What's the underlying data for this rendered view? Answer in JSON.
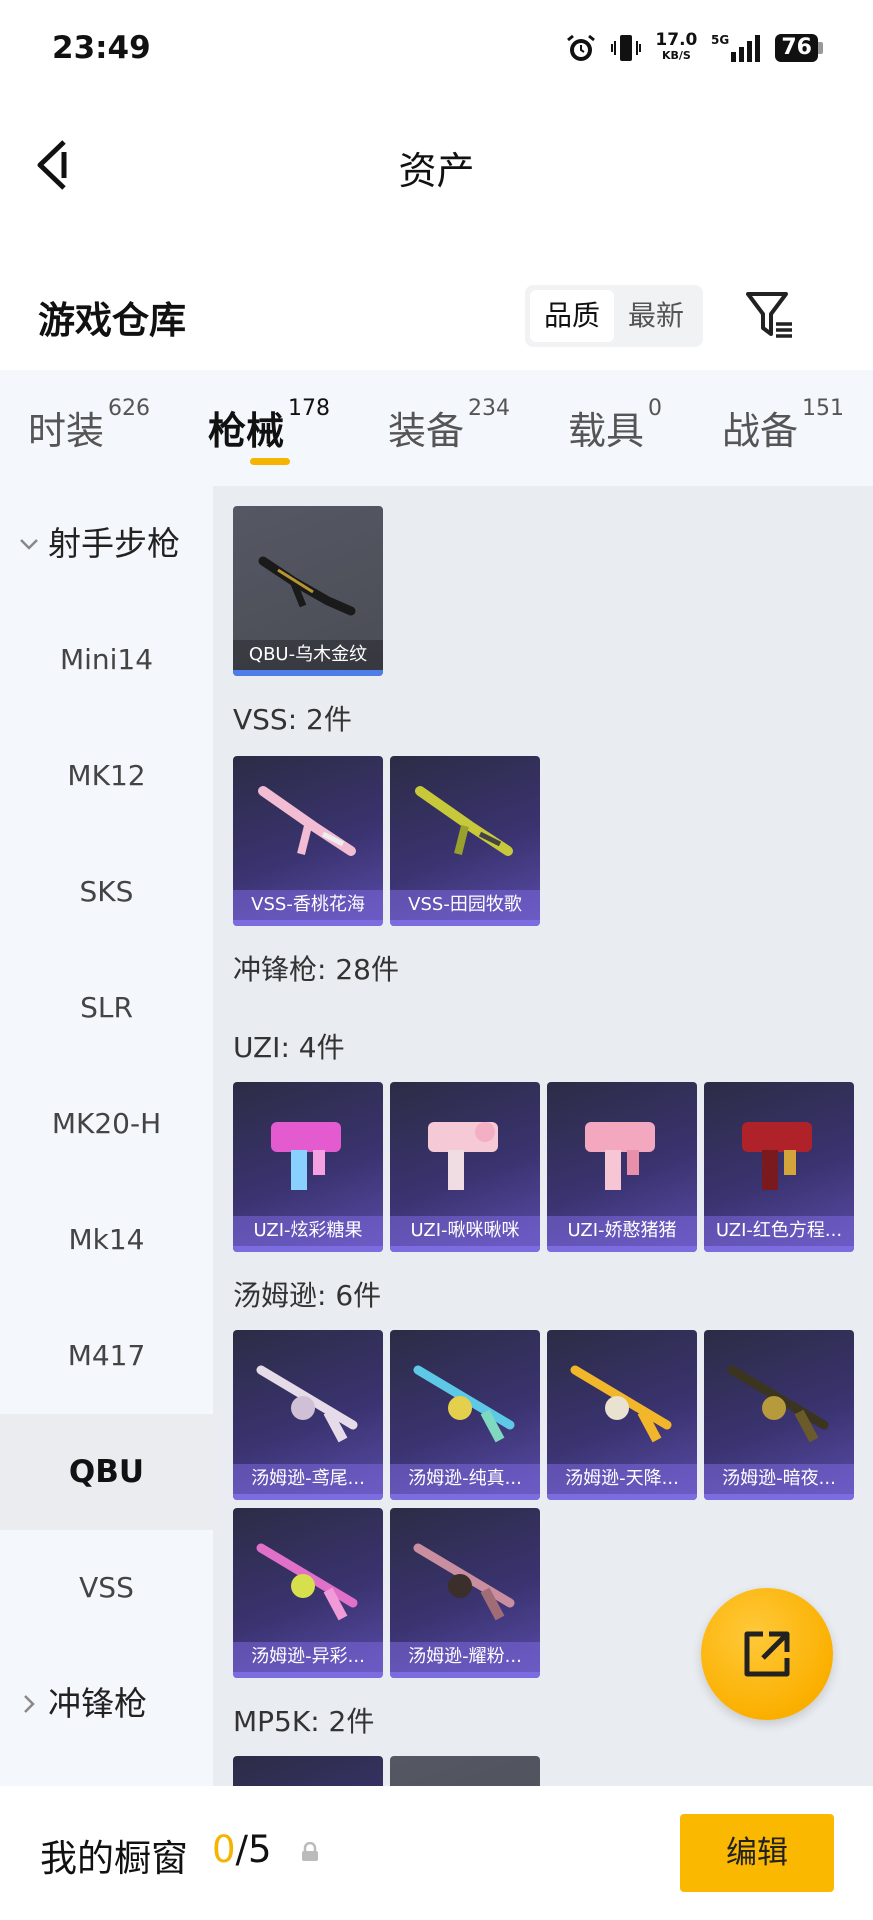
{
  "status_bar": {
    "time": "23:49",
    "net_speed": "17.0",
    "net_unit": "KB/S",
    "network": "5G",
    "battery": "76"
  },
  "nav": {
    "title": "资产"
  },
  "section": {
    "title": "游戏仓库",
    "sort_options": [
      "品质",
      "最新"
    ],
    "sort_selected": "品质"
  },
  "tabs": [
    {
      "label": "时装",
      "count": "626"
    },
    {
      "label": "枪械",
      "count": "178"
    },
    {
      "label": "装备",
      "count": "234"
    },
    {
      "label": "载具",
      "count": "0"
    },
    {
      "label": "战备",
      "count": "151"
    }
  ],
  "sidebar": {
    "group_1": "射手步枪",
    "items": [
      "Mini14",
      "MK12",
      "SKS",
      "SLR",
      "MK20-H",
      "Mk14",
      "M417",
      "QBU",
      "VSS"
    ],
    "active_item": "QBU",
    "group_2": "冲锋枪"
  },
  "content": {
    "qbu_cards": [
      "QBU-乌木金纹"
    ],
    "vss_label": "VSS: 2件",
    "vss_cards": [
      "VSS-香桃花海",
      "VSS-田园牧歌"
    ],
    "smg_label": "冲锋枪: 28件",
    "uzi_label": "UZI: 4件",
    "uzi_cards": [
      "UZI-炫彩糖果",
      "UZI-啾咪啾咪",
      "UZI-娇憨猪猪",
      "UZI-红色方程..."
    ],
    "tommy_label": "汤姆逊: 6件",
    "tommy_cards": [
      "汤姆逊-鸢尾...",
      "汤姆逊-纯真...",
      "汤姆逊-天降...",
      "汤姆逊-暗夜...",
      "汤姆逊-异彩...",
      "汤姆逊-耀粉..."
    ],
    "mp5k_label": "MP5K: 2件"
  },
  "bottom_bar": {
    "label": "我的橱窗",
    "current": "0",
    "separator": "/",
    "total": "5",
    "edit_label": "编辑"
  },
  "colors": {
    "accent": "#f5b400",
    "card_bg": "#3a3370",
    "card_label": "#7b6de0"
  }
}
